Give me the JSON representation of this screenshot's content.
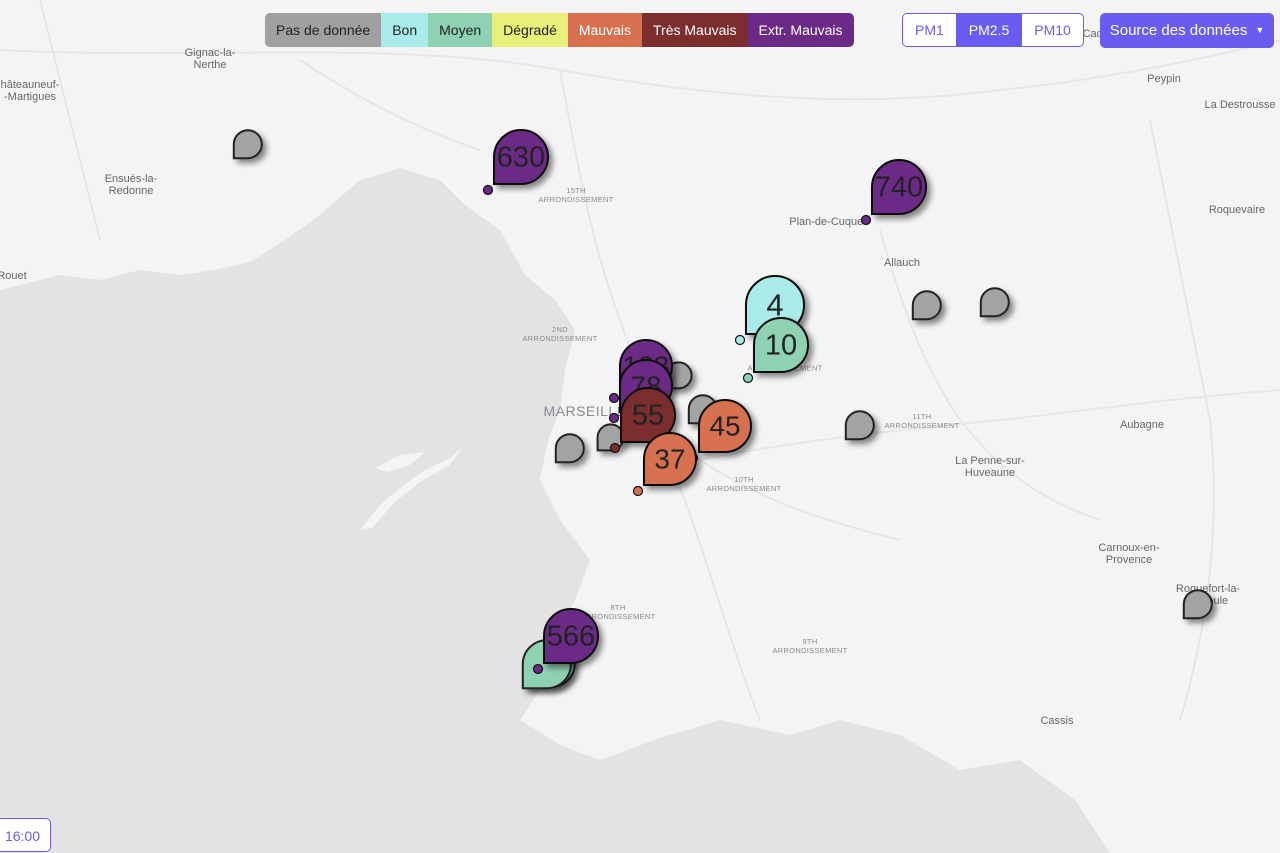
{
  "legend": [
    {
      "label": "Pas de donnée",
      "color": "#a0a0a0",
      "text_color": "#222"
    },
    {
      "label": "Bon",
      "color": "#a9ebe9",
      "text_color": "#222"
    },
    {
      "label": "Moyen",
      "color": "#8fd1b3",
      "text_color": "#222"
    },
    {
      "label": "Dégradé",
      "color": "#e8f07a",
      "text_color": "#222"
    },
    {
      "label": "Mauvais",
      "color": "#d7704f",
      "text_color": "#fff"
    },
    {
      "label": "Très Mauvais",
      "color": "#7c2d2d",
      "text_color": "#fff"
    },
    {
      "label": "Extr. Mauvais",
      "color": "#6b2a86",
      "text_color": "#fff"
    }
  ],
  "pm_buttons": [
    {
      "label": "PM1",
      "active": false
    },
    {
      "label": "PM2.5",
      "active": true
    },
    {
      "label": "PM10",
      "active": false
    }
  ],
  "source_button": {
    "label": "Source des données",
    "icon": "caret-down-icon"
  },
  "time_button": {
    "label": "16:00"
  },
  "places": {
    "gignac": "Gignac-la-\nNerthe",
    "chateauneuf": "hâteauneuf-\n-Martigues",
    "ensues": "Ensuès-la-\nRedonne",
    "rouet": "Rouet",
    "arr15": "15TH\nARRONDISSEMENT",
    "arr2": "2ND\nARRONDISSEMENT",
    "marseille": "MARSEILLE",
    "arr11": "11TH\nARRONDISSEMENT",
    "arr10": "10TH\nARRONDISSEMENT",
    "arr8": "8TH\nARRONDISSEMENT",
    "arr9": "9TH\nARRONDISSEMENT",
    "arr12": "ARRONDISSEMENT",
    "plan": "Plan-de-Cuques",
    "allauch": "Allauch",
    "peypin": "Peypin",
    "destrousse": "La Destrousse",
    "roquevaire": "Roquevaire",
    "aubagne": "Aubagne",
    "penne": "La Penne-sur-\nHuveaune",
    "carnoux": "Carnoux-en-\nProvence",
    "roquefort": "Roquefort-la-\nBédoule",
    "cassis": "Cassis",
    "cadolive": "Cadolive"
  },
  "markers": [
    {
      "value": "",
      "level": "none"
    },
    {
      "value": "630",
      "level": "extreme"
    },
    {
      "value": "740",
      "level": "extreme"
    },
    {
      "value": "",
      "level": "none"
    },
    {
      "value": "",
      "level": "none"
    },
    {
      "value": "4",
      "level": "good"
    },
    {
      "value": "10",
      "level": "moderate"
    },
    {
      "value": "",
      "level": "none"
    },
    {
      "value": "183",
      "level": "extreme"
    },
    {
      "value": "78",
      "level": "extreme"
    },
    {
      "value": "",
      "level": "none"
    },
    {
      "value": "",
      "level": "none"
    },
    {
      "value": "55",
      "level": "very_bad"
    },
    {
      "value": "45",
      "level": "bad"
    },
    {
      "value": "37",
      "level": "bad"
    },
    {
      "value": "",
      "level": "none"
    },
    {
      "value": "",
      "level": "none"
    },
    {
      "value": "",
      "level": "good"
    },
    {
      "value": "",
      "level": "moderate"
    },
    {
      "value": "566",
      "level": "extreme"
    },
    {
      "value": "",
      "level": "none"
    }
  ],
  "level_colors": {
    "none": "#a3a3a3",
    "good": "#a9ebe9",
    "moderate": "#8fd1b3",
    "bad": "#d7704f",
    "very_bad": "#7c2d2d",
    "extreme": "#6b2a86"
  }
}
